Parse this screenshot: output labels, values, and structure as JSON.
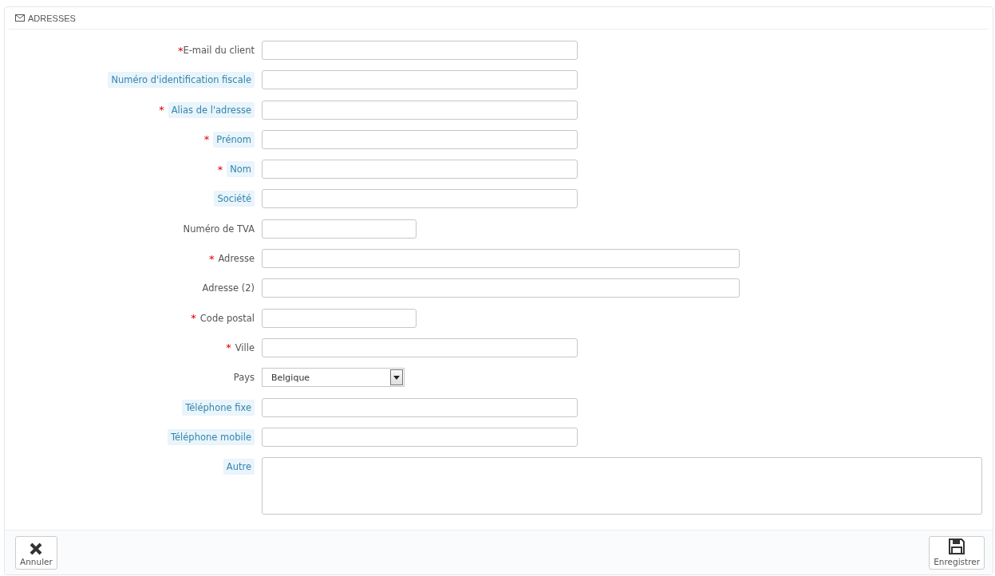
{
  "panel": {
    "title": "ADRESSES"
  },
  "fields": [
    {
      "label": "E-mail du client",
      "mark": "*",
      "hint": false,
      "kind": "text"
    },
    {
      "label": "Numéro d'identification fiscale",
      "hint": true,
      "kind": "text"
    },
    {
      "label": "Alias de l'adresse",
      "mark": "*",
      "hint": true,
      "kind": "text"
    },
    {
      "label": "Prénom",
      "mark": "*",
      "hint": true,
      "kind": "text"
    },
    {
      "label": "Nom",
      "mark": "*",
      "hint": true,
      "kind": "text"
    },
    {
      "label": "Société",
      "hint": true,
      "kind": "text"
    },
    {
      "label": "Numéro de TVA",
      "hint": false,
      "kind": "short"
    },
    {
      "label": "Adresse",
      "mark": "*",
      "hint": false,
      "kind": "long"
    },
    {
      "label": "Adresse (2)",
      "hint": false,
      "kind": "long"
    },
    {
      "label": "Code postal",
      "mark": "*",
      "hint": false,
      "kind": "short"
    },
    {
      "label": "Ville",
      "mark": "*",
      "hint": false,
      "kind": "text"
    },
    {
      "label": "Pays",
      "hint": false,
      "kind": "select",
      "value": "Belgique"
    },
    {
      "label": "Téléphone fixe",
      "hint": true,
      "kind": "text"
    },
    {
      "label": "Téléphone mobile",
      "hint": true,
      "kind": "text"
    },
    {
      "label": "Autre",
      "hint": true,
      "kind": "textarea"
    }
  ],
  "footer": {
    "cancel": "Annuler",
    "save": "Enregistrer"
  }
}
